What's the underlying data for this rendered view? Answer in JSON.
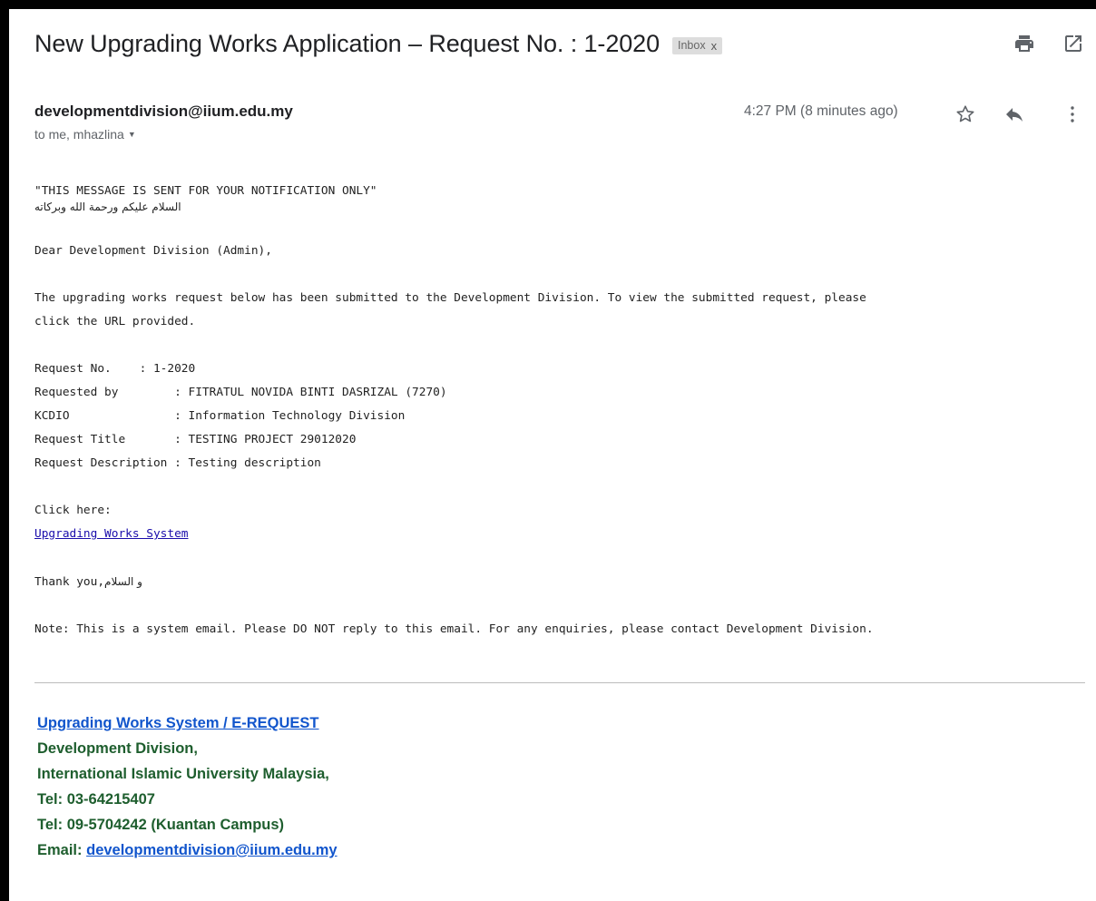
{
  "email": {
    "subject": "New Upgrading Works Application – Request No. : 1-2020",
    "label_chip": "Inbox",
    "label_remove": "x",
    "sender": "developmentdivision@iium.edu.my",
    "recipients": "to me, mhazlina",
    "time": "4:27 PM (8 minutes ago)"
  },
  "icons": {
    "print": "print-icon",
    "open_new": "open-in-new-window-icon",
    "star": "star-icon",
    "reply": "reply-icon",
    "more": "more-vertical-icon",
    "dropdown": "chevron-down-icon"
  },
  "body": {
    "notice": "\"THIS MESSAGE IS SENT FOR YOUR NOTIFICATION ONLY\"",
    "greeting_arabic": "السلام عليكم ورحمة الله وبركاته",
    "salutation": "Dear Development Division (Admin),",
    "intro_1": "The upgrading works request below has been submitted to the Development Division. To view the submitted request, please",
    "intro_2": "click the URL provided.",
    "details": [
      "Request No.    : 1-2020",
      "Requested by        : FITRATUL NOVIDA BINTI DASRIZAL (7270)",
      "KCDIO               : Information Technology Division",
      "Request Title       : TESTING PROJECT 29012020",
      "Request Description : Testing description"
    ],
    "click_here": "Click here:",
    "system_link": "Upgrading Works System",
    "thanks": "Thank you,",
    "closing_arabic": "و السلام",
    "note": "Note: This is a system email. Please DO NOT reply to this email. For any enquiries, please contact Development Division."
  },
  "signature": {
    "link": "Upgrading Works System / E-REQUEST",
    "dept": "Development Division,",
    "university": "International Islamic University Malaysia,",
    "tel1": "Tel: 03-64215407",
    "tel2": "Tel: 09-5704242 (Kuantan Campus)",
    "email_label": "Email: ",
    "email": "developmentdivision@iium.edu.my"
  },
  "colors": {
    "background": "#000000",
    "subject_text": "#202124",
    "meta_text": "#5f6368",
    "signature_green": "#1e5e2e",
    "link_blue": "#1155cc",
    "body_link": "#1a0dab",
    "icon_gray": "#5f6368"
  }
}
